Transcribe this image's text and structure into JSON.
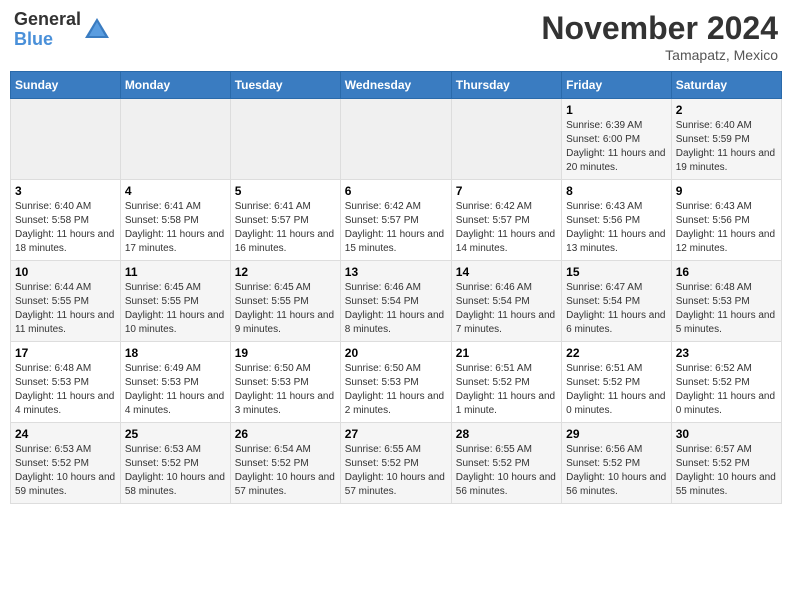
{
  "header": {
    "logo_line1": "General",
    "logo_line2": "Blue",
    "month": "November 2024",
    "location": "Tamapatz, Mexico"
  },
  "weekdays": [
    "Sunday",
    "Monday",
    "Tuesday",
    "Wednesday",
    "Thursday",
    "Friday",
    "Saturday"
  ],
  "weeks": [
    [
      {
        "day": "",
        "info": ""
      },
      {
        "day": "",
        "info": ""
      },
      {
        "day": "",
        "info": ""
      },
      {
        "day": "",
        "info": ""
      },
      {
        "day": "",
        "info": ""
      },
      {
        "day": "1",
        "info": "Sunrise: 6:39 AM\nSunset: 6:00 PM\nDaylight: 11 hours and 20 minutes."
      },
      {
        "day": "2",
        "info": "Sunrise: 6:40 AM\nSunset: 5:59 PM\nDaylight: 11 hours and 19 minutes."
      }
    ],
    [
      {
        "day": "3",
        "info": "Sunrise: 6:40 AM\nSunset: 5:58 PM\nDaylight: 11 hours and 18 minutes."
      },
      {
        "day": "4",
        "info": "Sunrise: 6:41 AM\nSunset: 5:58 PM\nDaylight: 11 hours and 17 minutes."
      },
      {
        "day": "5",
        "info": "Sunrise: 6:41 AM\nSunset: 5:57 PM\nDaylight: 11 hours and 16 minutes."
      },
      {
        "day": "6",
        "info": "Sunrise: 6:42 AM\nSunset: 5:57 PM\nDaylight: 11 hours and 15 minutes."
      },
      {
        "day": "7",
        "info": "Sunrise: 6:42 AM\nSunset: 5:57 PM\nDaylight: 11 hours and 14 minutes."
      },
      {
        "day": "8",
        "info": "Sunrise: 6:43 AM\nSunset: 5:56 PM\nDaylight: 11 hours and 13 minutes."
      },
      {
        "day": "9",
        "info": "Sunrise: 6:43 AM\nSunset: 5:56 PM\nDaylight: 11 hours and 12 minutes."
      }
    ],
    [
      {
        "day": "10",
        "info": "Sunrise: 6:44 AM\nSunset: 5:55 PM\nDaylight: 11 hours and 11 minutes."
      },
      {
        "day": "11",
        "info": "Sunrise: 6:45 AM\nSunset: 5:55 PM\nDaylight: 11 hours and 10 minutes."
      },
      {
        "day": "12",
        "info": "Sunrise: 6:45 AM\nSunset: 5:55 PM\nDaylight: 11 hours and 9 minutes."
      },
      {
        "day": "13",
        "info": "Sunrise: 6:46 AM\nSunset: 5:54 PM\nDaylight: 11 hours and 8 minutes."
      },
      {
        "day": "14",
        "info": "Sunrise: 6:46 AM\nSunset: 5:54 PM\nDaylight: 11 hours and 7 minutes."
      },
      {
        "day": "15",
        "info": "Sunrise: 6:47 AM\nSunset: 5:54 PM\nDaylight: 11 hours and 6 minutes."
      },
      {
        "day": "16",
        "info": "Sunrise: 6:48 AM\nSunset: 5:53 PM\nDaylight: 11 hours and 5 minutes."
      }
    ],
    [
      {
        "day": "17",
        "info": "Sunrise: 6:48 AM\nSunset: 5:53 PM\nDaylight: 11 hours and 4 minutes."
      },
      {
        "day": "18",
        "info": "Sunrise: 6:49 AM\nSunset: 5:53 PM\nDaylight: 11 hours and 4 minutes."
      },
      {
        "day": "19",
        "info": "Sunrise: 6:50 AM\nSunset: 5:53 PM\nDaylight: 11 hours and 3 minutes."
      },
      {
        "day": "20",
        "info": "Sunrise: 6:50 AM\nSunset: 5:53 PM\nDaylight: 11 hours and 2 minutes."
      },
      {
        "day": "21",
        "info": "Sunrise: 6:51 AM\nSunset: 5:52 PM\nDaylight: 11 hours and 1 minute."
      },
      {
        "day": "22",
        "info": "Sunrise: 6:51 AM\nSunset: 5:52 PM\nDaylight: 11 hours and 0 minutes."
      },
      {
        "day": "23",
        "info": "Sunrise: 6:52 AM\nSunset: 5:52 PM\nDaylight: 11 hours and 0 minutes."
      }
    ],
    [
      {
        "day": "24",
        "info": "Sunrise: 6:53 AM\nSunset: 5:52 PM\nDaylight: 10 hours and 59 minutes."
      },
      {
        "day": "25",
        "info": "Sunrise: 6:53 AM\nSunset: 5:52 PM\nDaylight: 10 hours and 58 minutes."
      },
      {
        "day": "26",
        "info": "Sunrise: 6:54 AM\nSunset: 5:52 PM\nDaylight: 10 hours and 57 minutes."
      },
      {
        "day": "27",
        "info": "Sunrise: 6:55 AM\nSunset: 5:52 PM\nDaylight: 10 hours and 57 minutes."
      },
      {
        "day": "28",
        "info": "Sunrise: 6:55 AM\nSunset: 5:52 PM\nDaylight: 10 hours and 56 minutes."
      },
      {
        "day": "29",
        "info": "Sunrise: 6:56 AM\nSunset: 5:52 PM\nDaylight: 10 hours and 56 minutes."
      },
      {
        "day": "30",
        "info": "Sunrise: 6:57 AM\nSunset: 5:52 PM\nDaylight: 10 hours and 55 minutes."
      }
    ]
  ]
}
